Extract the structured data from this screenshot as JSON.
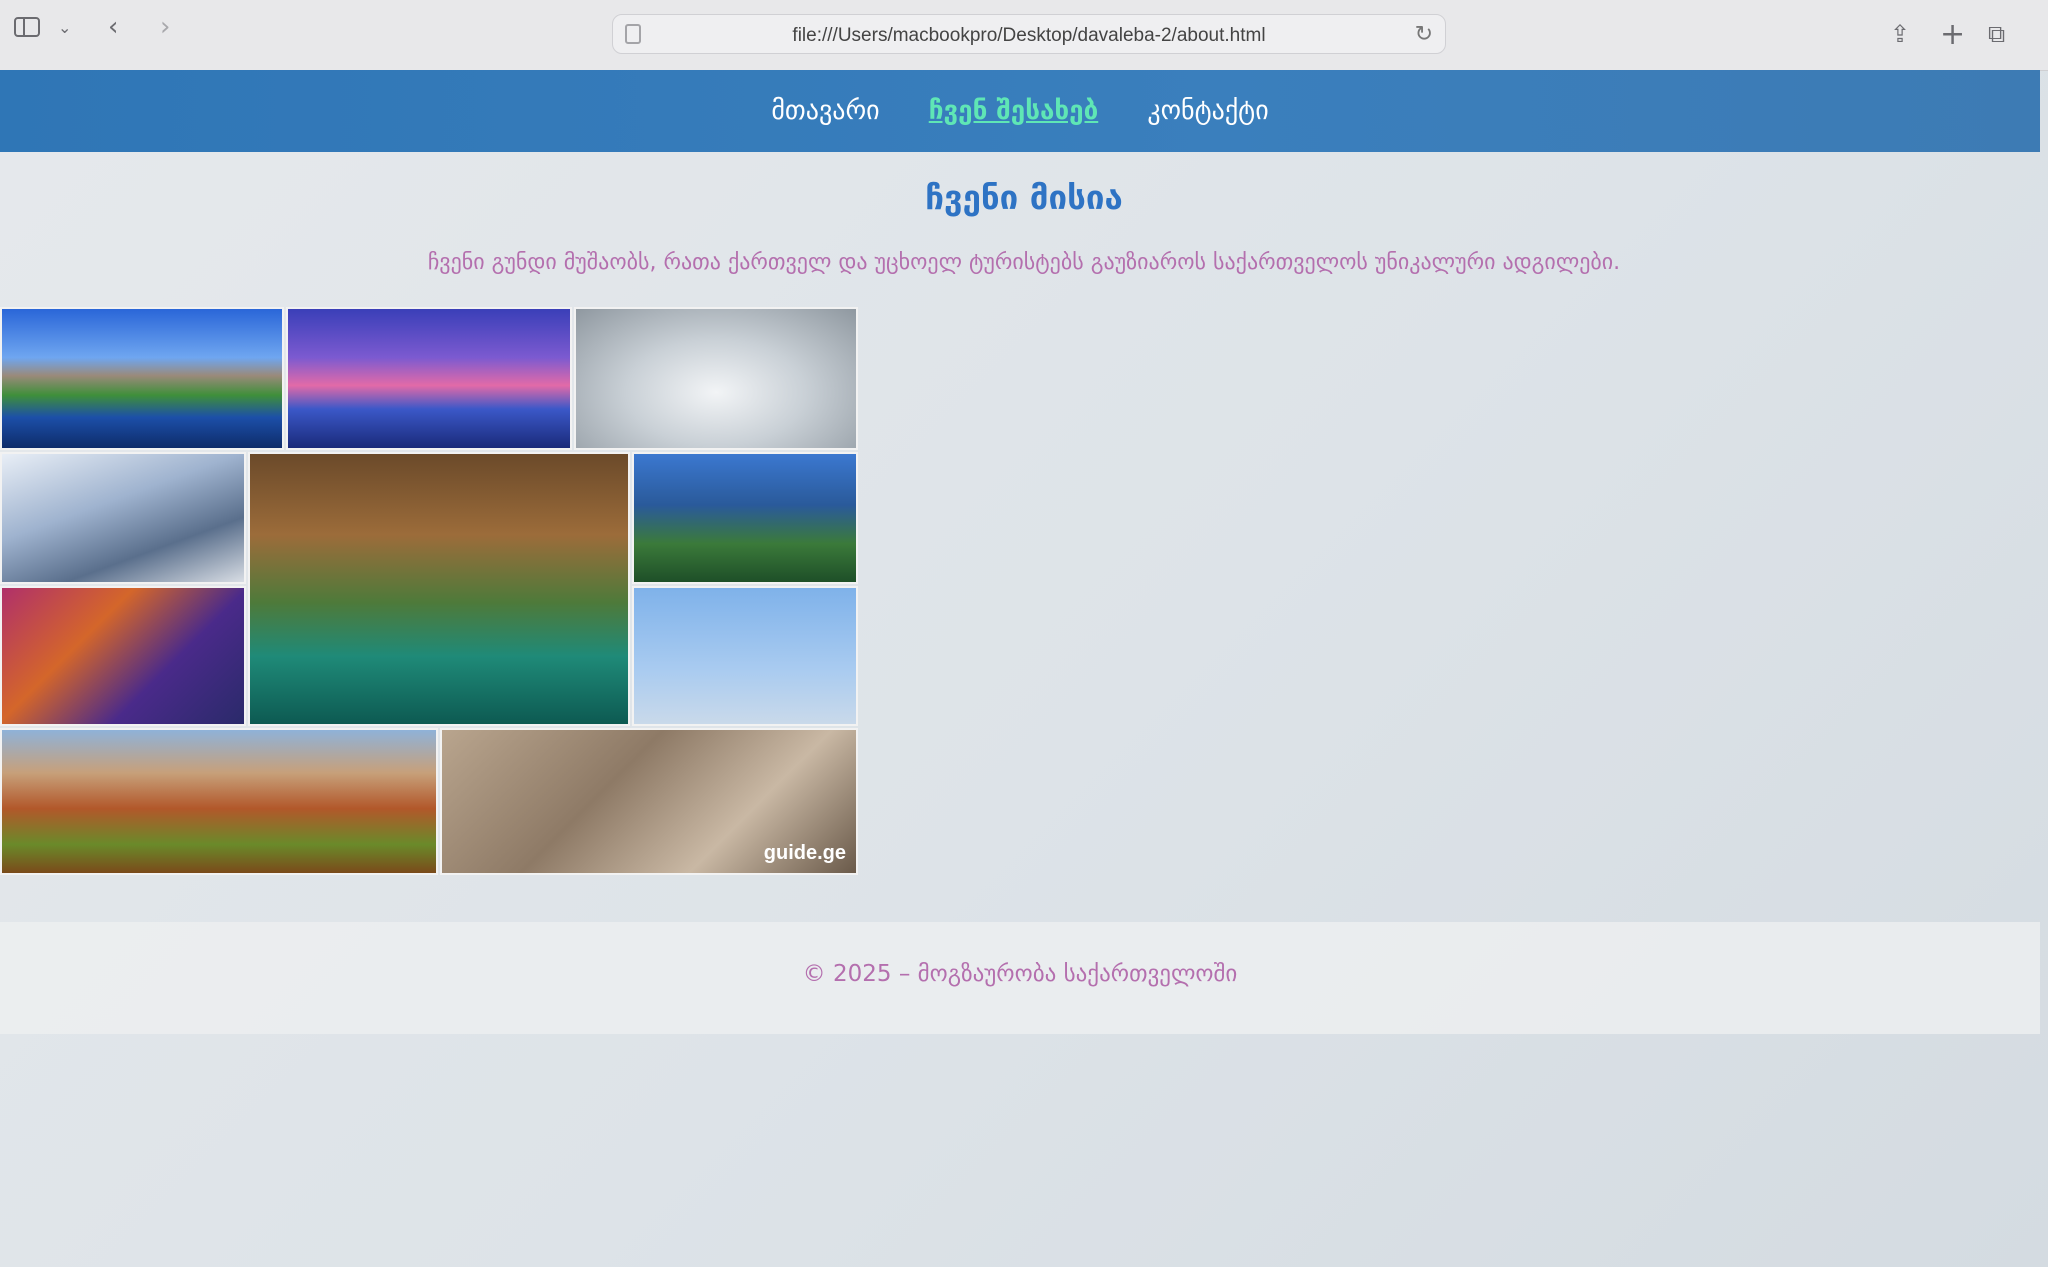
{
  "browser": {
    "url": "file:///Users/macbookpro/Desktop/davaleba-2/about.html"
  },
  "nav": {
    "items": [
      {
        "label": "მთავარი",
        "active": false
      },
      {
        "label": "ჩვენ შესახებ",
        "active": true
      },
      {
        "label": "კონტაქტი",
        "active": false
      }
    ]
  },
  "main": {
    "title": "ჩვენი მისია",
    "text": "ჩვენი გუნდი მუშაობს, რათა ქართველ და უცხოელ ტურისტებს გაუზიაროს საქართველოს უნიკალური ადგილები.",
    "collage_watermark": "guide.ge"
  },
  "footer": {
    "text": "© 2025 – მოგზაურობა საქართველოში"
  },
  "colors": {
    "nav_bg": "#2f76b6",
    "nav_active": "#5fe6b5",
    "title": "#2e73c4",
    "accent_text": "#b46fae"
  }
}
